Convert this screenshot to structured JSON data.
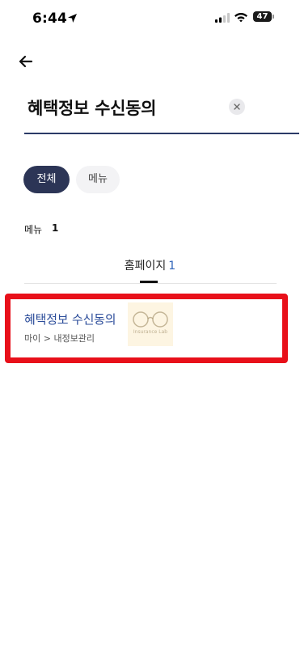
{
  "status_bar": {
    "time": "6:44",
    "battery": "47"
  },
  "search": {
    "query": "혜택정보 수신동의"
  },
  "filters": {
    "all_label": "전체",
    "menu_label": "메뉴"
  },
  "section": {
    "label": "메뉴",
    "count": "1"
  },
  "tab": {
    "label": "홈페이지",
    "count": "1"
  },
  "results": [
    {
      "title": "혜택정보 수신동의",
      "path": "마이 > 내정보관리"
    }
  ],
  "watermark": {
    "text": "Insurance Lab"
  },
  "colors": {
    "accent_navy": "#2c3556",
    "link_blue": "#2b4c9a",
    "highlight_red": "#e8101a"
  }
}
